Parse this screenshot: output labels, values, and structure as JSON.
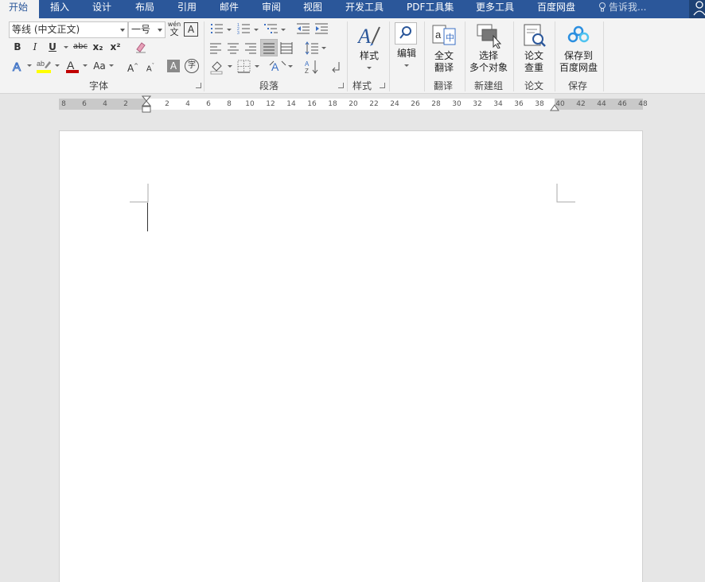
{
  "tabs": [
    {
      "label": "开始",
      "active": true
    },
    {
      "label": "插入"
    },
    {
      "label": "设计"
    },
    {
      "label": "布局"
    },
    {
      "label": "引用"
    },
    {
      "label": "邮件"
    },
    {
      "label": "审阅"
    },
    {
      "label": "视图"
    },
    {
      "label": "开发工具"
    },
    {
      "label": "PDF工具集"
    },
    {
      "label": "更多工具"
    },
    {
      "label": "百度网盘"
    }
  ],
  "tell_me": "告诉我...",
  "font_group": {
    "font_name": "等线 (中文正文)",
    "font_size": "一号",
    "phonetic_top": "wén",
    "phonetic_bottom": "文",
    "bold": "B",
    "italic": "I",
    "underline": "U",
    "strike": "abc",
    "subscript": "x₂",
    "superscript": "x²",
    "font_color_letter": "A",
    "change_case": "Aa",
    "grow": "A",
    "shrink": "A",
    "char_shade": "A",
    "enclose": "字",
    "label": "字体"
  },
  "paragraph_group": {
    "label": "段落"
  },
  "styles_group": {
    "button": "样式",
    "label": "样式"
  },
  "editing": {
    "button": "编辑"
  },
  "translate_group": {
    "line1": "全文",
    "line2": "翻译",
    "label": "翻译"
  },
  "newgroup": {
    "line1": "选择",
    "line2": "多个对象",
    "label": "新建组"
  },
  "paper_group": {
    "line1": "论文",
    "line2": "查重",
    "label": "论文"
  },
  "save_group": {
    "line1": "保存到",
    "line2": "百度网盘",
    "label": "保存"
  },
  "ruler": {
    "left_ticks": [
      "8",
      "6",
      "4",
      "2"
    ],
    "right_ticks": [
      "2",
      "4",
      "6",
      "8",
      "10",
      "12",
      "14",
      "16",
      "18",
      "20",
      "22",
      "24",
      "26",
      "28",
      "30",
      "32",
      "34",
      "36",
      "38",
      "40",
      "42",
      "44",
      "46",
      "48"
    ]
  },
  "colors": {
    "tab_bar": "#2b579a",
    "ribbon": "#f3f3f3",
    "highlight": "#ffff00",
    "font_color": "#c00000",
    "accent_blue": "#2b579a"
  }
}
